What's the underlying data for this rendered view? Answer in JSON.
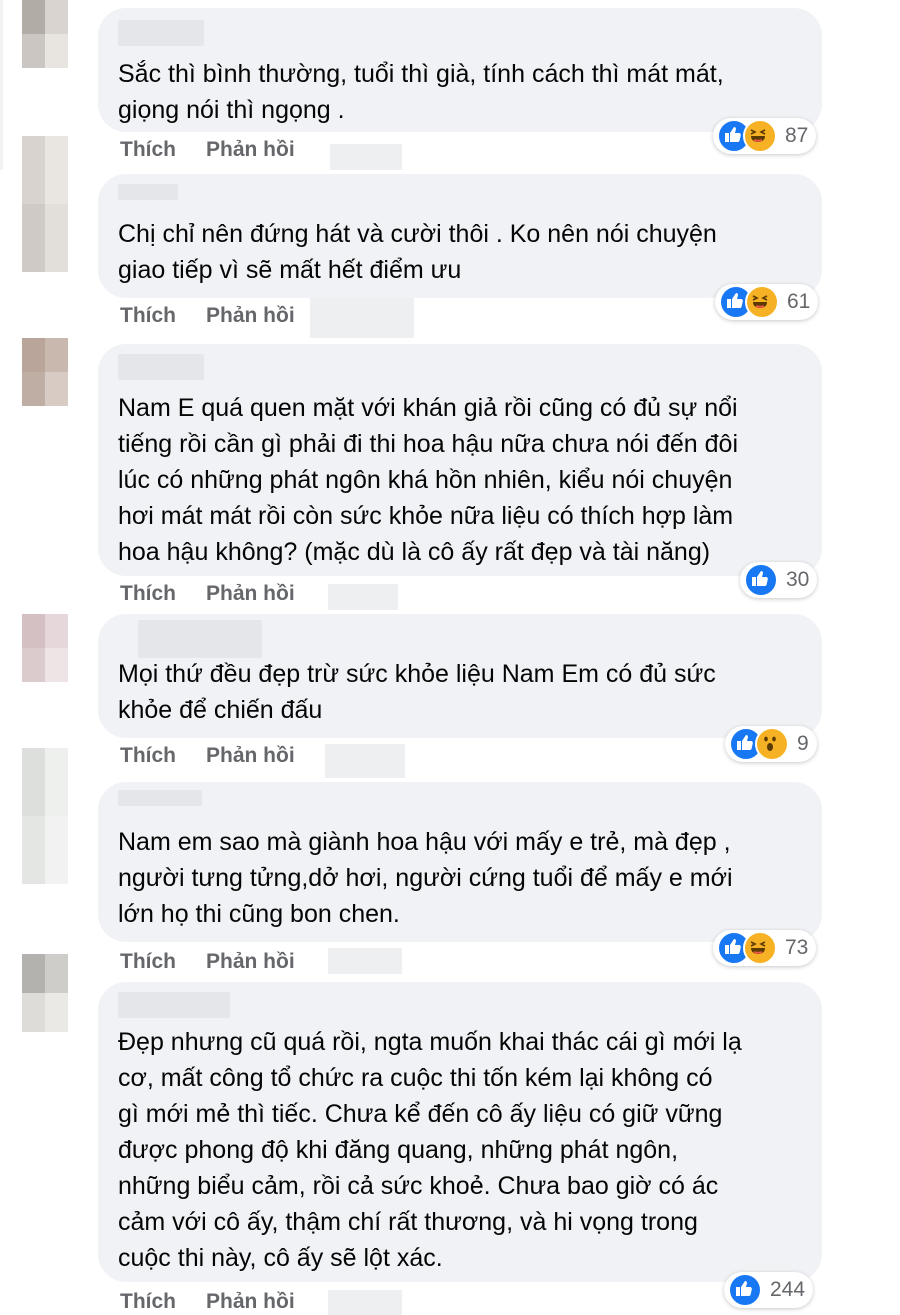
{
  "actions": {
    "like_label": "Thích",
    "reply_label": "Phản hồi"
  },
  "colors": {
    "like": "#1877f2",
    "haha": "#f7b125",
    "bubble": "#f0f2f5",
    "action_text": "#65676b"
  },
  "comments": [
    {
      "text": "Sắc thì bình thường, tuổi thì già, tính cách thì mát mát,\ngiọng nói thì ngọng .",
      "reaction_icons": [
        "like-icon",
        "haha-icon"
      ],
      "reaction_count": "87"
    },
    {
      "text": "Chị chỉ nên đứng hát và cười thôi . Ko nên nói chuyện\ngiao tiếp vì sẽ mất hết điểm ưu",
      "reaction_icons": [
        "like-icon",
        "haha-icon"
      ],
      "reaction_count": "61"
    },
    {
      "text": "Nam E quá quen mặt với khán giả rồi cũng có đủ sự nổi\ntiếng rồi cần gì phải đi thi hoa hậu nữa chưa nói đến đôi\nlúc có những phát ngôn khá hồn nhiên, kiểu nói chuyện\nhơi mát mát rồi còn sức khỏe nữa liệu có thích hợp làm\nhoa hậu không? (mặc dù là cô ấy rất đẹp và tài năng)",
      "reaction_icons": [
        "like-icon"
      ],
      "reaction_count": "30"
    },
    {
      "text": "Mọi thứ đều đẹp trừ sức khỏe liệu Nam Em có đủ sức\nkhỏe để chiến đấu",
      "reaction_icons": [
        "like-icon",
        "wow-icon"
      ],
      "reaction_count": "9"
    },
    {
      "text": "Nam em sao mà giành hoa hậu với mấy e trẻ, mà đẹp ,\nngười tưng tửng,dở hơi, người cứng tuổi để mấy e mới\nlớn họ thi cũng bon chen.",
      "reaction_icons": [
        "like-icon",
        "haha-icon"
      ],
      "reaction_count": "73"
    },
    {
      "text": "Đẹp nhưng cũ quá rồi, ngta muốn khai thác cái gì mới lạ\ncơ, mất công tổ chức ra cuộc thi tốn kém lại không có\ngì mới mẻ thì tiếc. Chưa kể đến cô ấy liệu có giữ vững\nđược phong độ khi đăng quang, những phát ngôn,\nnhững biểu cảm, rồi cả sức khoẻ. Chưa bao giờ có ác\ncảm với cô ấy, thậm chí rất thương, và hi vọng trong\ncuộc thi này, cô ấy sẽ lột xác.",
      "reaction_icons": [
        "like-icon"
      ],
      "reaction_count": "244"
    }
  ]
}
